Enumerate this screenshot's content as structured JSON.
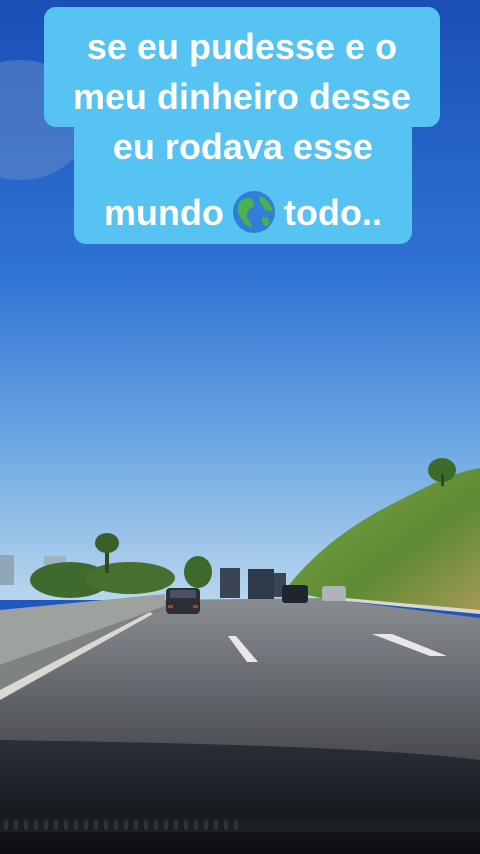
{
  "caption": {
    "lines": [
      "se eu pudesse e  o",
      "meu dinheiro desse",
      "eu rodava esse",
      "mundo",
      "todo.."
    ],
    "emoji": "globe-americas-icon",
    "bg_color": "#56c3f2",
    "text_color": "#ffffff"
  },
  "scene": {
    "description_colors": {
      "sky_top": "#1e56c3",
      "sky_horizon": "#a8ccec",
      "road": "#5c5e64",
      "hill": "#6f9a3a",
      "dashboard": "#14171c"
    }
  }
}
